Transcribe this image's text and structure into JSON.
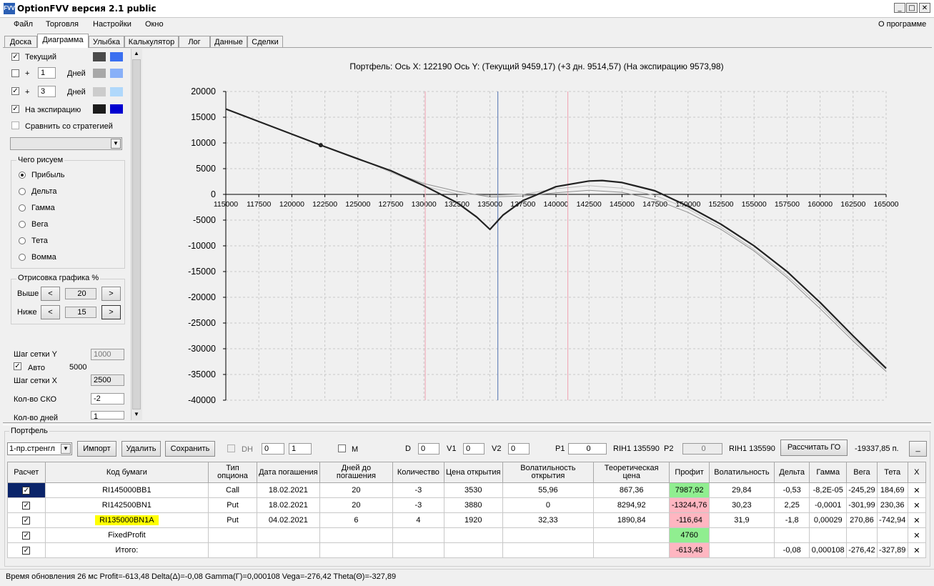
{
  "window": {
    "title": "OptionFVV версия 2.1 public",
    "app_icon": "FVV"
  },
  "window_buttons": {
    "minimize": "_",
    "maximize": "□",
    "close": "✕"
  },
  "menu": [
    "Файл",
    "Торговля",
    "Настройки",
    "Окно"
  ],
  "menu_right": "О программе",
  "tabs": [
    "Доска",
    "Диаграмма",
    "Улыбка",
    "Калькулятор",
    "Лог",
    "Данные",
    "Сделки"
  ],
  "active_tab": "Диаграмма",
  "left": {
    "current_label": "Текущий",
    "plus": "+",
    "days_label": "Дней",
    "days1": "1",
    "days2": "3",
    "expiry_label": "На экспирацию",
    "compare_label": "Сравнить со стратегией",
    "draw_group": "Чего рисуем",
    "radios": [
      "Прибыль",
      "Дельта",
      "Гамма",
      "Вега",
      "Тета",
      "Вомма"
    ],
    "selected_radio": "Прибыль",
    "render_group": "Отрисовка графика %",
    "above_label": "Выше",
    "above_value": "20",
    "below_label": "Ниже",
    "below_value": "15",
    "arrow_left": "<",
    "arrow_right": ">",
    "grid_y_label": "Шаг сетки Y",
    "grid_y_value": "1000",
    "auto_label": "Авто",
    "auto_value": "5000",
    "grid_x_label": "Шаг сетки X",
    "grid_x_value": "2500",
    "sko_label": "Кол-во СКО",
    "sko_value": "-2",
    "days_count_label": "Кол-во дней",
    "days_count_value": "1",
    "colors": {
      "current": [
        "#4a4a4a",
        "#3a6ff0"
      ],
      "plus1": [
        "#a8a8a8",
        "#88b0f8"
      ],
      "plus3": [
        "#cccccc",
        "#b0d8fb"
      ],
      "expiry": [
        "#1c1c1c",
        "#0000d0"
      ]
    }
  },
  "chart_data": {
    "type": "line",
    "title": "Портфель: Ось X: 122190 Ось Y:  (Текущий 9459,17)  (+3 дн. 9514,57)  (На экспирацию 9573,98)",
    "xlim": [
      115000,
      165000
    ],
    "ylim": [
      -40000,
      20000
    ],
    "x_ticks": [
      115000,
      117500,
      120000,
      122500,
      125000,
      127500,
      130000,
      132500,
      135000,
      137500,
      140000,
      142500,
      145000,
      147500,
      150000,
      152500,
      155000,
      157500,
      160000,
      162500,
      165000
    ],
    "y_ticks": [
      20000,
      15000,
      10000,
      5000,
      0,
      -5000,
      -10000,
      -15000,
      -20000,
      -25000,
      -30000,
      -35000,
      -40000
    ],
    "grid": true,
    "vertical_lines": [
      {
        "x": 130100,
        "color": "#f0a0b0"
      },
      {
        "x": 135600,
        "color": "#5070b0"
      },
      {
        "x": 140900,
        "color": "#f0a0b0"
      }
    ],
    "marker": {
      "x": 122190,
      "y": 9574
    },
    "series": [
      {
        "color": "#222222",
        "width": 2.2,
        "points": [
          [
            115000,
            16600
          ],
          [
            122190,
            9574
          ],
          [
            125000,
            6900
          ],
          [
            127500,
            4600
          ],
          [
            130000,
            1700
          ],
          [
            132500,
            -1600
          ],
          [
            134000,
            -4400
          ],
          [
            135000,
            -6800
          ],
          [
            136000,
            -4000
          ],
          [
            137500,
            -1200
          ],
          [
            140000,
            1500
          ],
          [
            142500,
            2600
          ],
          [
            143500,
            2700
          ],
          [
            145000,
            2300
          ],
          [
            147500,
            700
          ],
          [
            150000,
            -2300
          ],
          [
            152500,
            -5800
          ],
          [
            155000,
            -10000
          ],
          [
            157500,
            -15000
          ],
          [
            160000,
            -21000
          ],
          [
            162500,
            -27500
          ],
          [
            165000,
            -33800
          ]
        ]
      },
      {
        "color": "#909090",
        "width": 1,
        "points": [
          [
            115000,
            16600
          ],
          [
            122190,
            9560
          ],
          [
            125000,
            7000
          ],
          [
            127500,
            4500
          ],
          [
            130000,
            2100
          ],
          [
            132500,
            600
          ],
          [
            135000,
            -500
          ],
          [
            137500,
            -300
          ],
          [
            140000,
            300
          ],
          [
            142500,
            800
          ],
          [
            145000,
            400
          ],
          [
            147500,
            -1000
          ],
          [
            150000,
            -3500
          ],
          [
            152500,
            -6800
          ],
          [
            155000,
            -11000
          ],
          [
            157500,
            -16200
          ],
          [
            160000,
            -22200
          ],
          [
            162500,
            -28500
          ],
          [
            165000,
            -34400
          ]
        ]
      },
      {
        "color": "#bcbcbc",
        "width": 1,
        "points": [
          [
            115000,
            16600
          ],
          [
            122190,
            9500
          ],
          [
            125000,
            7000
          ],
          [
            127500,
            4300
          ],
          [
            130000,
            1600
          ],
          [
            132500,
            100
          ],
          [
            135000,
            -200
          ],
          [
            137500,
            0
          ],
          [
            140000,
            1100
          ],
          [
            142500,
            1700
          ],
          [
            145000,
            1200
          ],
          [
            147500,
            -200
          ],
          [
            150000,
            -2800
          ],
          [
            152500,
            -6400
          ],
          [
            155000,
            -10700
          ],
          [
            157500,
            -15800
          ],
          [
            160000,
            -21600
          ],
          [
            162500,
            -28000
          ],
          [
            165000,
            -34000
          ]
        ]
      }
    ]
  },
  "portfolio": {
    "group_label": "Портфель",
    "combo_value": "1-пр.стренгл",
    "buttons": [
      "Импорт",
      "Удалить",
      "Сохранить"
    ],
    "dh_label": "DH",
    "dh_spin1": "0",
    "dh_spin2": "1",
    "m_label": "M",
    "d_label": "D",
    "d_value": "0",
    "v1_label": "V1",
    "v1_value": "0",
    "v2_label": "V2",
    "v2_value": "0",
    "p1_label": "P1",
    "p1_value": "0",
    "rih_p1": "RIH1 135590",
    "p2_label": "P2",
    "p2_value": "0",
    "rih_p2": "RIH1 135590",
    "calc_button": "Рассчитать ГО",
    "go_value": "-19337,85 п.",
    "min_button": "_"
  },
  "table": {
    "headers": [
      "Расчет",
      "Код бумаги",
      "Тип опциона",
      "Дата погашения",
      "Дней до погашения",
      "Количество",
      "Цена открытия",
      "Волатильность открытия",
      "Теоретическая цена",
      "Профит",
      "Волатильность",
      "Дельта",
      "Гамма",
      "Вега",
      "Тета",
      "X"
    ],
    "rows": [
      {
        "code": "RI145000BB1",
        "type": "Call",
        "date": "18.02.2021",
        "days": "20",
        "qty": "-3",
        "price": "3530",
        "vol_open": "55,96",
        "theo": "867,36",
        "profit": "7987,92",
        "vol": "29,84",
        "delta": "-0,53",
        "gamma": "-8,2E-05",
        "vega": "-245,29",
        "theta": "184,69",
        "x": "✕"
      },
      {
        "code": "RI142500BN1",
        "type": "Put",
        "date": "18.02.2021",
        "days": "20",
        "qty": "-3",
        "price": "3880",
        "vol_open": "0",
        "theo": "8294,92",
        "profit": "-13244,76",
        "vol": "30,23",
        "delta": "2,25",
        "gamma": "-0,0001",
        "vega": "-301,99",
        "theta": "230,36",
        "x": "✕"
      },
      {
        "code": "RI135000BN1A",
        "type": "Put",
        "date": "04.02.2021",
        "days": "6",
        "qty": "4",
        "price": "1920",
        "vol_open": "32,33",
        "theo": "1890,84",
        "profit": "-116,64",
        "vol": "31,9",
        "delta": "-1,8",
        "gamma": "0,00029",
        "vega": "270,86",
        "theta": "-742,94",
        "x": "✕"
      },
      {
        "code": "FixedProfit",
        "type": "",
        "date": "",
        "days": "",
        "qty": "",
        "price": "",
        "vol_open": "",
        "theo": "",
        "profit": "4760",
        "vol": "",
        "delta": "",
        "gamma": "",
        "vega": "",
        "theta": "",
        "x": "✕"
      },
      {
        "code": "Итого:",
        "type": "",
        "date": "",
        "days": "",
        "qty": "",
        "price": "",
        "vol_open": "",
        "theo": "",
        "profit": "-613,48",
        "vol": "",
        "delta": "-0,08",
        "gamma": "0,000108",
        "vega": "-276,42",
        "theta": "-327,89",
        "x": "✕"
      }
    ]
  },
  "status": "Время обновления 26 мс  Profit=-613,48 Delta(Δ)=-0,08 Gamma(Γ)=0,000108 Vega=-276,42 Theta(Θ)=-327,89"
}
